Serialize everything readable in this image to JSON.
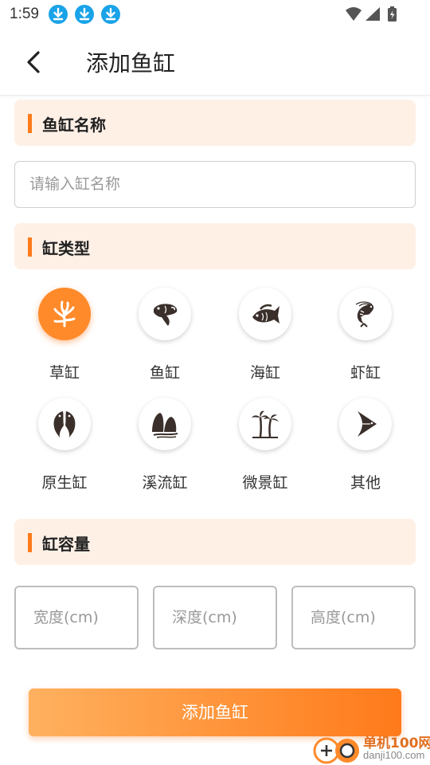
{
  "status_bar": {
    "time": "1:59",
    "download_icons": [
      "download-icon",
      "download-icon",
      "download-icon"
    ],
    "system_icons": [
      "wifi-icon",
      "signal-icon",
      "battery-icon"
    ]
  },
  "header": {
    "back_icon": "chevron-left-icon",
    "title": "添加鱼缸"
  },
  "sections": {
    "name": {
      "label": "鱼缸名称",
      "input_placeholder": "请输入缸名称"
    },
    "type": {
      "label": "缸类型",
      "selected": "草缸",
      "items": [
        {
          "label": "草缸",
          "icon": "aquatic-plant-icon"
        },
        {
          "label": "鱼缸",
          "icon": "goldfish-icon"
        },
        {
          "label": "海缸",
          "icon": "marine-fish-icon"
        },
        {
          "label": "虾缸",
          "icon": "shrimp-icon"
        },
        {
          "label": "原生缸",
          "icon": "native-fish-pair-icon"
        },
        {
          "label": "溪流缸",
          "icon": "stream-rocks-icon"
        },
        {
          "label": "微景缸",
          "icon": "palm-tree-icon"
        },
        {
          "label": "其他",
          "icon": "angelfish-icon"
        }
      ]
    },
    "capacity": {
      "label": "缸容量",
      "inputs": [
        {
          "placeholder": "宽度(cm)"
        },
        {
          "placeholder": "深度(cm)"
        },
        {
          "placeholder": "高度(cm)"
        }
      ]
    }
  },
  "add_button": {
    "label": "添加鱼缸"
  },
  "watermark": {
    "line1": "单机100网",
    "line2": "danji100.com"
  },
  "colors": {
    "accent": "#ff7a1a",
    "section_bg": "#fff0e6",
    "download_badge": "#1aa3e8"
  }
}
